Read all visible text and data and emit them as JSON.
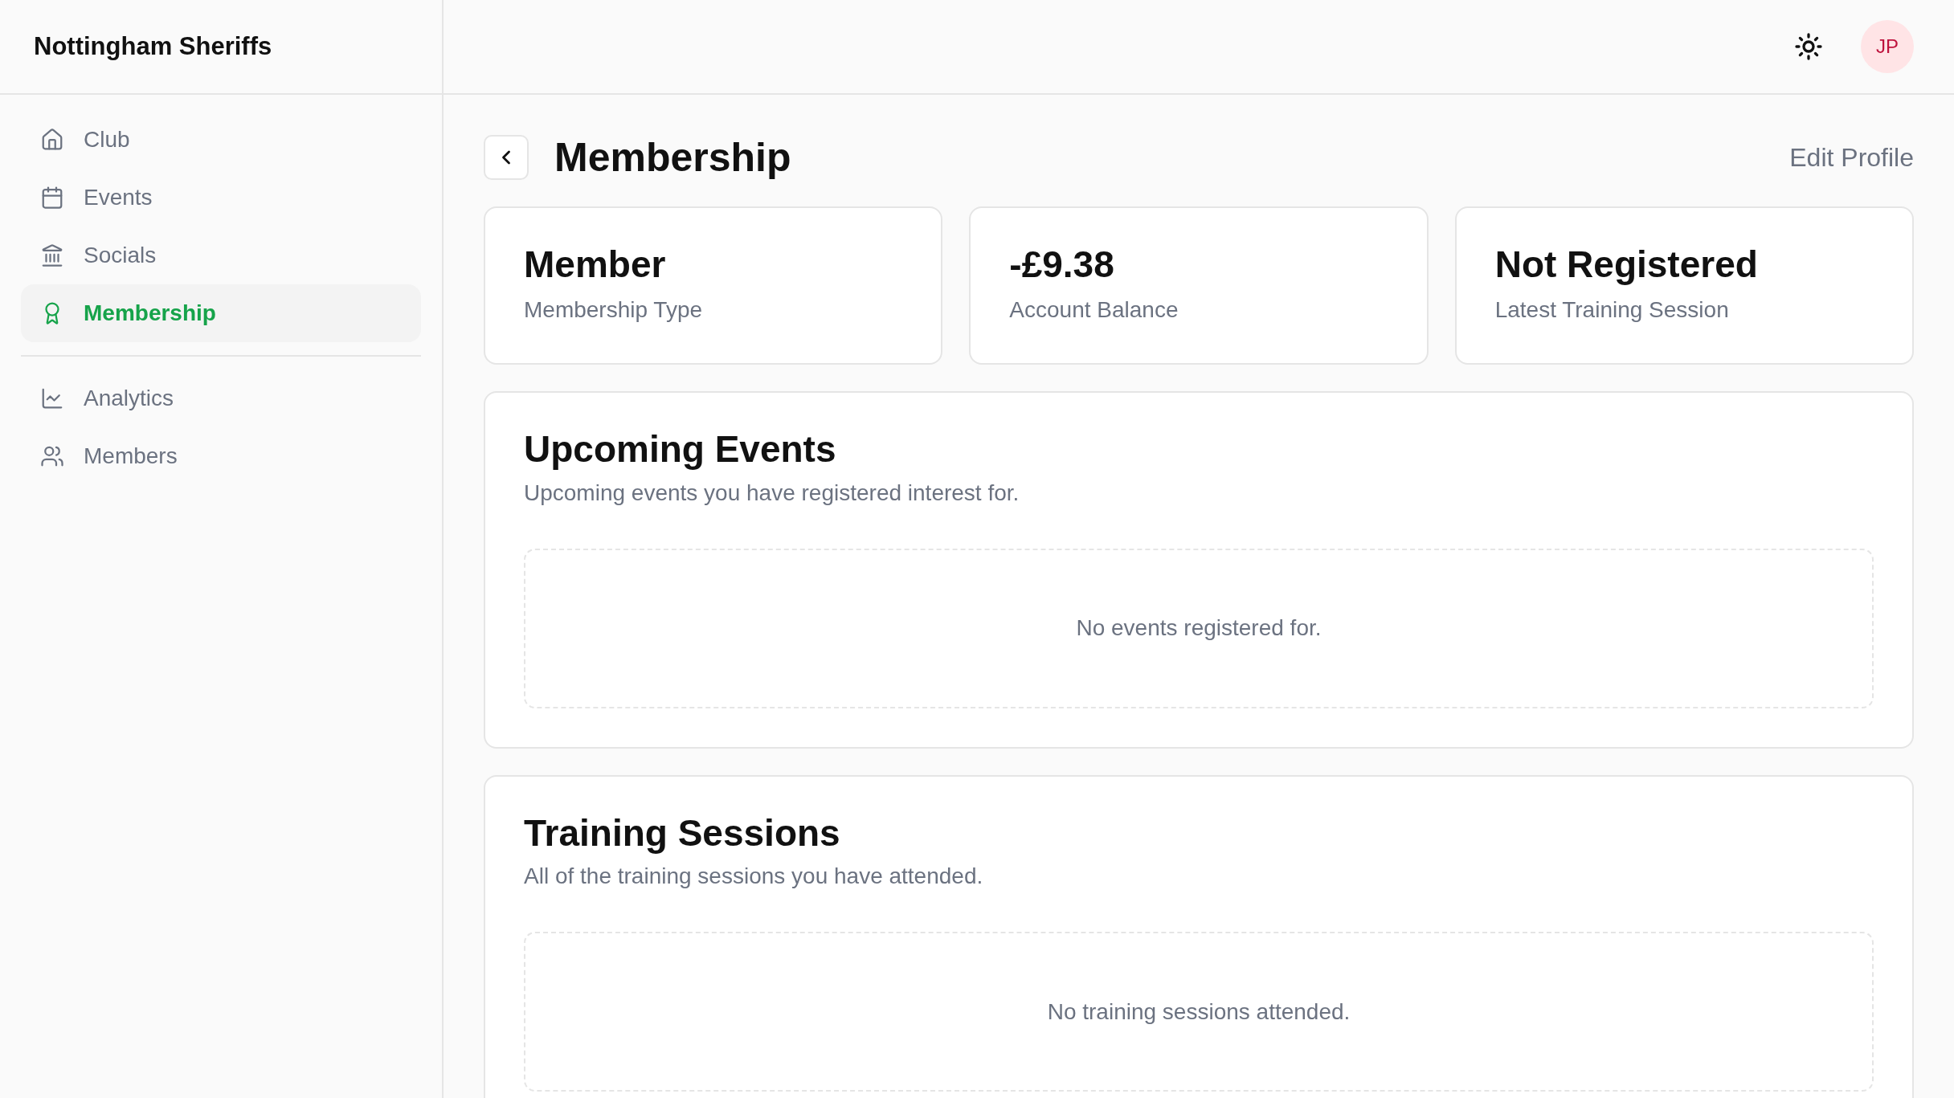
{
  "brand": "Nottingham Sheriffs",
  "nav_groups": [
    [
      {
        "label": "Club",
        "selected": false
      },
      {
        "label": "Events",
        "selected": false
      },
      {
        "label": "Socials",
        "selected": false
      },
      {
        "label": "Membership",
        "selected": true
      }
    ],
    [
      {
        "label": "Analytics",
        "selected": false
      },
      {
        "label": "Members",
        "selected": false
      }
    ]
  ],
  "avatar": "JP",
  "page": {
    "title": "Membership",
    "action": "Edit Profile"
  },
  "stats": [
    {
      "value": "Member",
      "label": "Membership Type"
    },
    {
      "value": "-£9.38",
      "label": "Account Balance"
    },
    {
      "value": "Not Registered",
      "label": "Latest Training Session"
    }
  ],
  "sections": [
    {
      "title": "Upcoming Events",
      "subtitle": "Upcoming events you have registered interest for.",
      "empty": "No events registered for."
    },
    {
      "title": "Training Sessions",
      "subtitle": "All of the training sessions you have attended.",
      "empty": "No training sessions attended."
    }
  ]
}
